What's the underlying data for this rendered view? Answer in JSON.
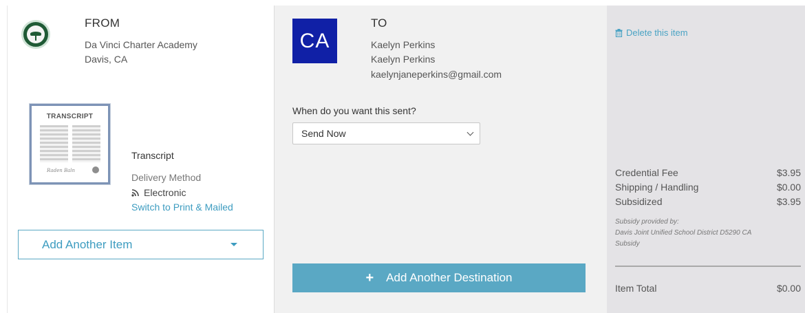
{
  "from": {
    "heading": "FROM",
    "school_name": "Da Vinci Charter Academy",
    "school_location": "Davis, CA",
    "logo_icon": "school-logo"
  },
  "document": {
    "thumbnail_title": "TRANSCRIPT",
    "item_name": "Transcript",
    "delivery_label": "Delivery Method",
    "delivery_value": "Electronic",
    "delivery_icon": "rss-icon",
    "switch_link": "Switch to Print & Mailed"
  },
  "add_item": {
    "label": "Add Another Item",
    "icon": "caret-down-icon"
  },
  "to": {
    "heading": "TO",
    "avatar_initials": "CA",
    "recipient_line1": "Kaelyn Perkins",
    "recipient_line2": "Kaelyn Perkins",
    "email": "kaelynjaneperkins@gmail.com"
  },
  "send_timing": {
    "label": "When do you want this sent?",
    "selected": "Send Now"
  },
  "add_destination": {
    "label": "Add Another Destination",
    "icon": "plus-icon"
  },
  "fees": {
    "delete_label": "Delete this item",
    "delete_icon": "trash-icon",
    "rows": [
      {
        "label": "Credential Fee",
        "amount": "$3.95"
      },
      {
        "label": "Shipping / Handling",
        "amount": "$0.00"
      },
      {
        "label": "Subsidized",
        "amount": "$3.95"
      }
    ],
    "subsidy_note_line1": "Subsidy provided by:",
    "subsidy_note_line2": "Davis Joint Unified School District D5290 CA",
    "subsidy_note_line3": "Subsidy",
    "total_label": "Item Total",
    "total_amount": "$0.00"
  },
  "colors": {
    "accent": "#5aa8c4",
    "link": "#3d9cc0",
    "avatar_bg": "#1020a6",
    "logo_green": "#1f5a35",
    "fees_bg": "#e4e3e6",
    "to_bg": "#f1f1f1"
  }
}
